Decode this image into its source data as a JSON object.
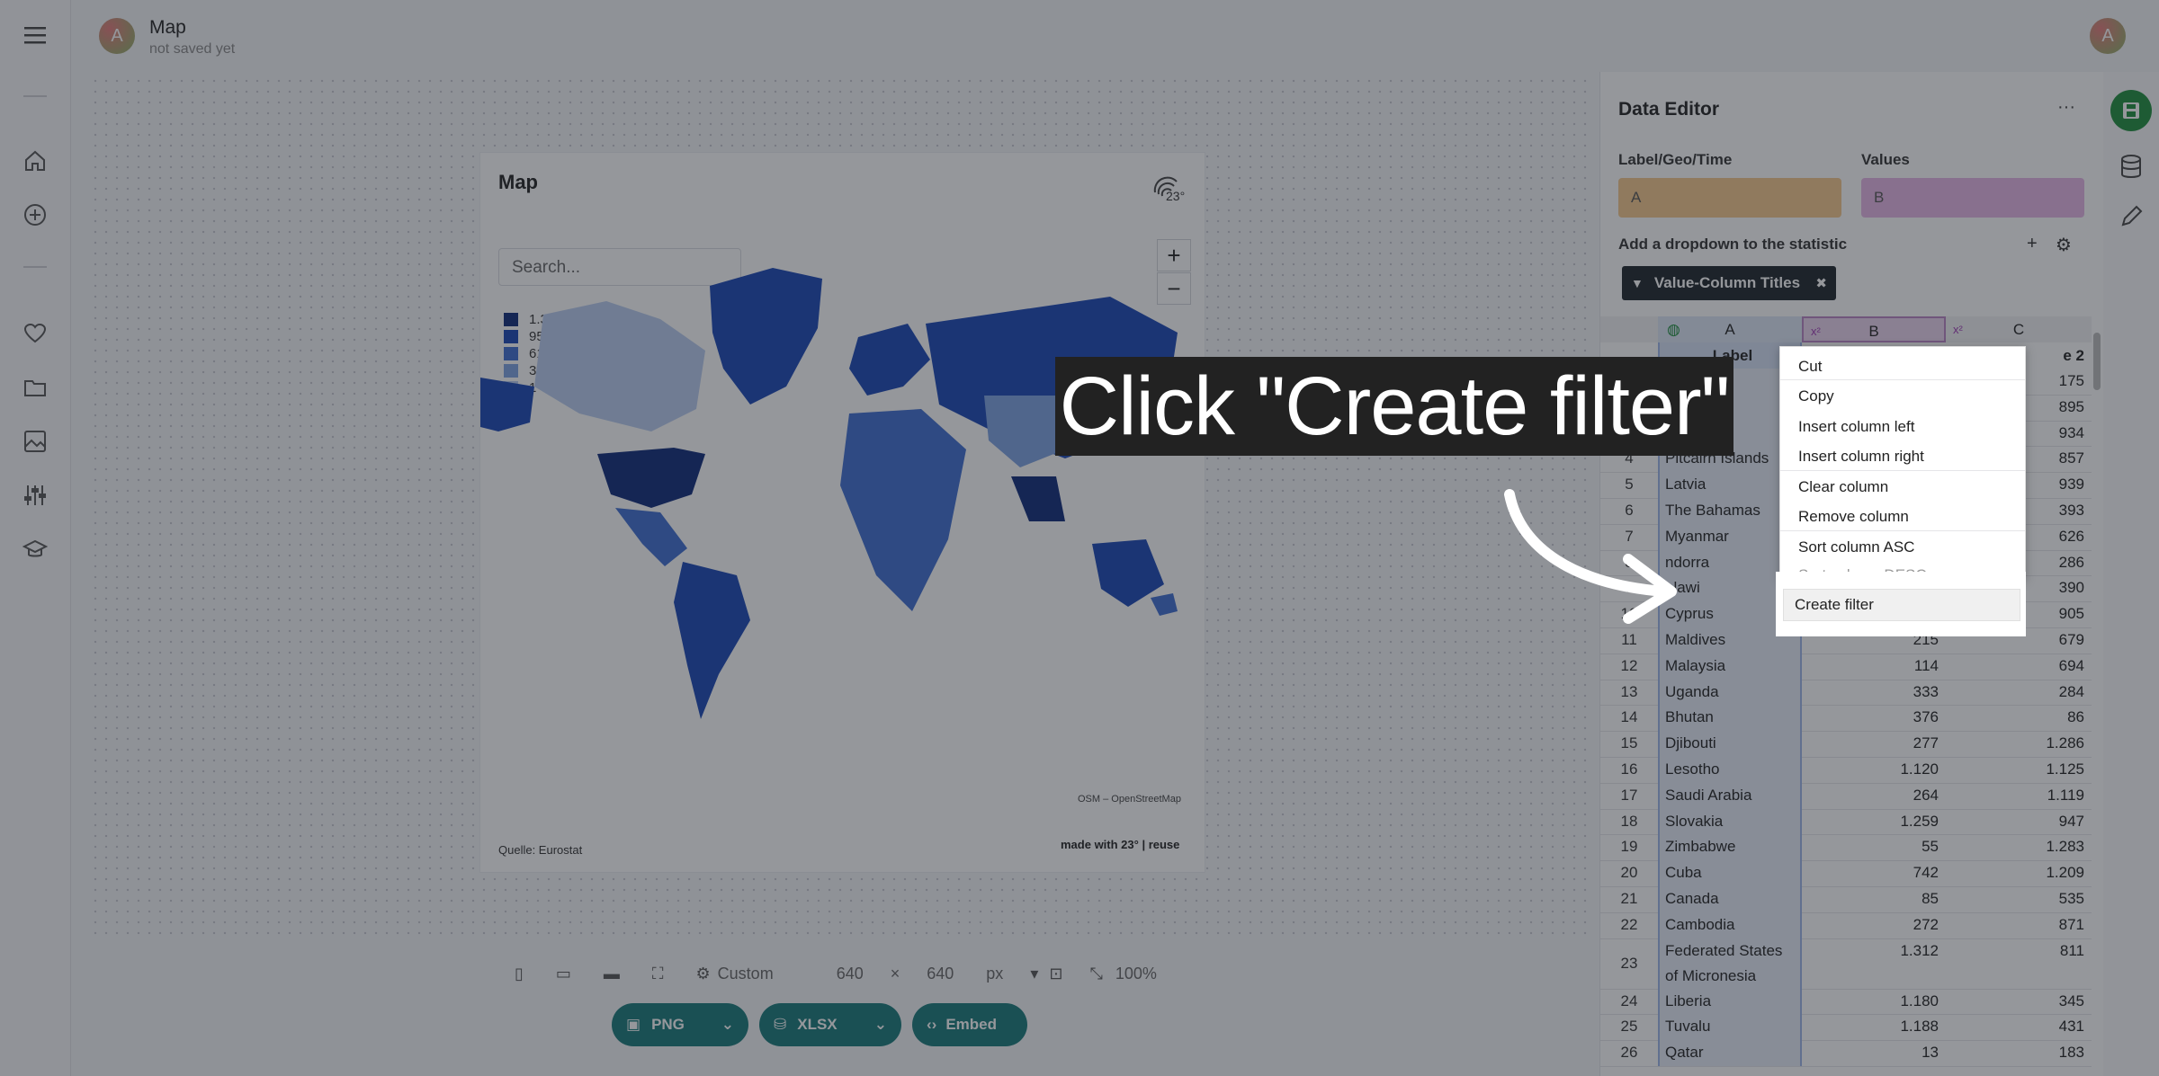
{
  "header": {
    "title": "Map",
    "subtitle": "not saved yet",
    "avatar_letter": "A"
  },
  "rail": {
    "icons": [
      "menu-icon",
      "home-icon",
      "add-icon",
      "heart-icon",
      "folder-icon",
      "image-icon",
      "sliders-icon",
      "school-icon"
    ]
  },
  "map": {
    "title": "Map",
    "search_placeholder": "Search...",
    "legend": [
      {
        "label": "1.312",
        "color": "#0f2a7a"
      },
      {
        "label": "959",
        "color": "#1a46b5"
      },
      {
        "label": "617",
        "color": "#3f6fd1"
      },
      {
        "label": "315",
        "color": "#7ea2e2"
      },
      {
        "label": "1",
        "color": "#b9cdf0"
      }
    ],
    "zoom_in": "+",
    "zoom_out": "−",
    "attribution": "OSM – OpenStreetMap",
    "source": "Quelle: Eurostat",
    "made_with": "made with 23° | reuse",
    "logo_text": "23°"
  },
  "toolbar": {
    "size_mode": "Custom",
    "width": "640",
    "height": "640",
    "unit": "px",
    "times": "×",
    "zoom": "100%"
  },
  "export": {
    "png": "PNG",
    "xlsx": "XLSX",
    "embed": "Embed"
  },
  "editor": {
    "title": "Data Editor",
    "more": "···",
    "label_geo_time": "Label/Geo/Time",
    "values": "Values",
    "label_field": "A",
    "values_field": "B",
    "dropdown_label": "Add a dropdown to the statistic",
    "plus": "+",
    "chip": "Value-Column Titles",
    "chip_close": "✖",
    "columns": [
      "A",
      "B",
      "C"
    ],
    "col_type_b": "x²",
    "col_type_c": "x²",
    "header_row": {
      "a": "Label",
      "c": "e 2"
    },
    "rows": [
      {
        "n": "",
        "a": "",
        "b": "",
        "c": "175"
      },
      {
        "n": "",
        "a": "negal",
        "b": "",
        "c": "895"
      },
      {
        "n": "",
        "a": "itzerland",
        "b": "",
        "c": "934"
      },
      {
        "n": "4",
        "a": "Pitcairn Islands",
        "b": "",
        "c": "857"
      },
      {
        "n": "5",
        "a": "Latvia",
        "b": "",
        "c": "939"
      },
      {
        "n": "6",
        "a": "The Bahamas",
        "b": "",
        "c": "393"
      },
      {
        "n": "7",
        "a": "Myanmar",
        "b": "",
        "c": "626"
      },
      {
        "n": "8",
        "a": "ndorra",
        "b": "",
        "c": "286"
      },
      {
        "n": "9",
        "a": "alawi",
        "b": "",
        "c": "390"
      },
      {
        "n": "10",
        "a": "Cyprus",
        "b": "84",
        "c": "905"
      },
      {
        "n": "11",
        "a": "Maldives",
        "b": "215",
        "c": "679"
      },
      {
        "n": "12",
        "a": "Malaysia",
        "b": "114",
        "c": "694"
      },
      {
        "n": "13",
        "a": "Uganda",
        "b": "333",
        "c": "284"
      },
      {
        "n": "14",
        "a": "Bhutan",
        "b": "376",
        "c": "86"
      },
      {
        "n": "15",
        "a": "Djibouti",
        "b": "277",
        "c": "1.286"
      },
      {
        "n": "16",
        "a": "Lesotho",
        "b": "1.120",
        "c": "1.125"
      },
      {
        "n": "17",
        "a": "Saudi Arabia",
        "b": "264",
        "c": "1.119"
      },
      {
        "n": "18",
        "a": "Slovakia",
        "b": "1.259",
        "c": "947"
      },
      {
        "n": "19",
        "a": "Zimbabwe",
        "b": "55",
        "c": "1.283"
      },
      {
        "n": "20",
        "a": "Cuba",
        "b": "742",
        "c": "1.209"
      },
      {
        "n": "21",
        "a": "Canada",
        "b": "85",
        "c": "535"
      },
      {
        "n": "22",
        "a": "Cambodia",
        "b": "272",
        "c": "871"
      },
      {
        "n": "23",
        "a": "Federated States",
        "a2": "of Micronesia",
        "b": "1.312",
        "c": "811"
      },
      {
        "n": "24",
        "a": "Liberia",
        "b": "1.180",
        "c": "345"
      },
      {
        "n": "25",
        "a": "Tuvalu",
        "b": "1.188",
        "c": "431"
      },
      {
        "n": "26",
        "a": "Qatar",
        "b": "13",
        "c": "183"
      }
    ]
  },
  "context_menu": {
    "items": [
      "Cut",
      "Copy",
      "Insert column left",
      "Insert column right",
      "Clear column",
      "Remove column",
      "Sort column ASC"
    ],
    "partial_item": "Sort column DESC",
    "highlight": "Create filter"
  },
  "instruction": {
    "text": "Click \"Create filter\""
  }
}
